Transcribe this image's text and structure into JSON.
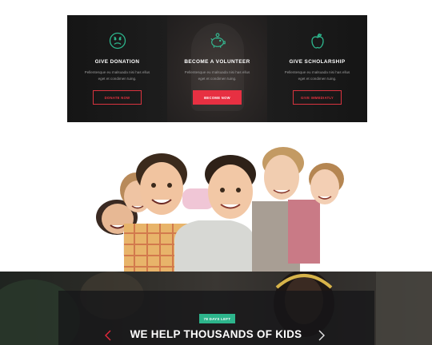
{
  "cards": [
    {
      "title": "GIVE DONATION",
      "text": "Pellentesque eu malsuada nisi has ellus eget et condimen tuing.",
      "button": "DONATE NOW",
      "icon": "sad-face-icon"
    },
    {
      "title": "BECOME A VOLUNTEER",
      "text": "Pellentesque eu malsuada nisi has ellus eget et condimen tuing.",
      "button": "BECOME NOW",
      "icon": "piggy-bank-icon"
    },
    {
      "title": "GIVE SCHOLARSHIP",
      "text": "Pellentesque eu malsuada nisi has ellus eget et condimen tuing.",
      "button": "GIVE IMMEDIATLY",
      "icon": "apple-icon"
    }
  ],
  "campaign": {
    "badge": "78 DAYS LEFT",
    "headline": "WE HELP THOUSANDS OF KIDS",
    "prev_icon": "chevron-left-icon",
    "next_icon": "chevron-right-icon"
  },
  "colors": {
    "accent_red": "#e6283b",
    "icon_green": "#2db58c",
    "badge_green": "#2db58c",
    "panel_dark": "#1b1b1b"
  }
}
